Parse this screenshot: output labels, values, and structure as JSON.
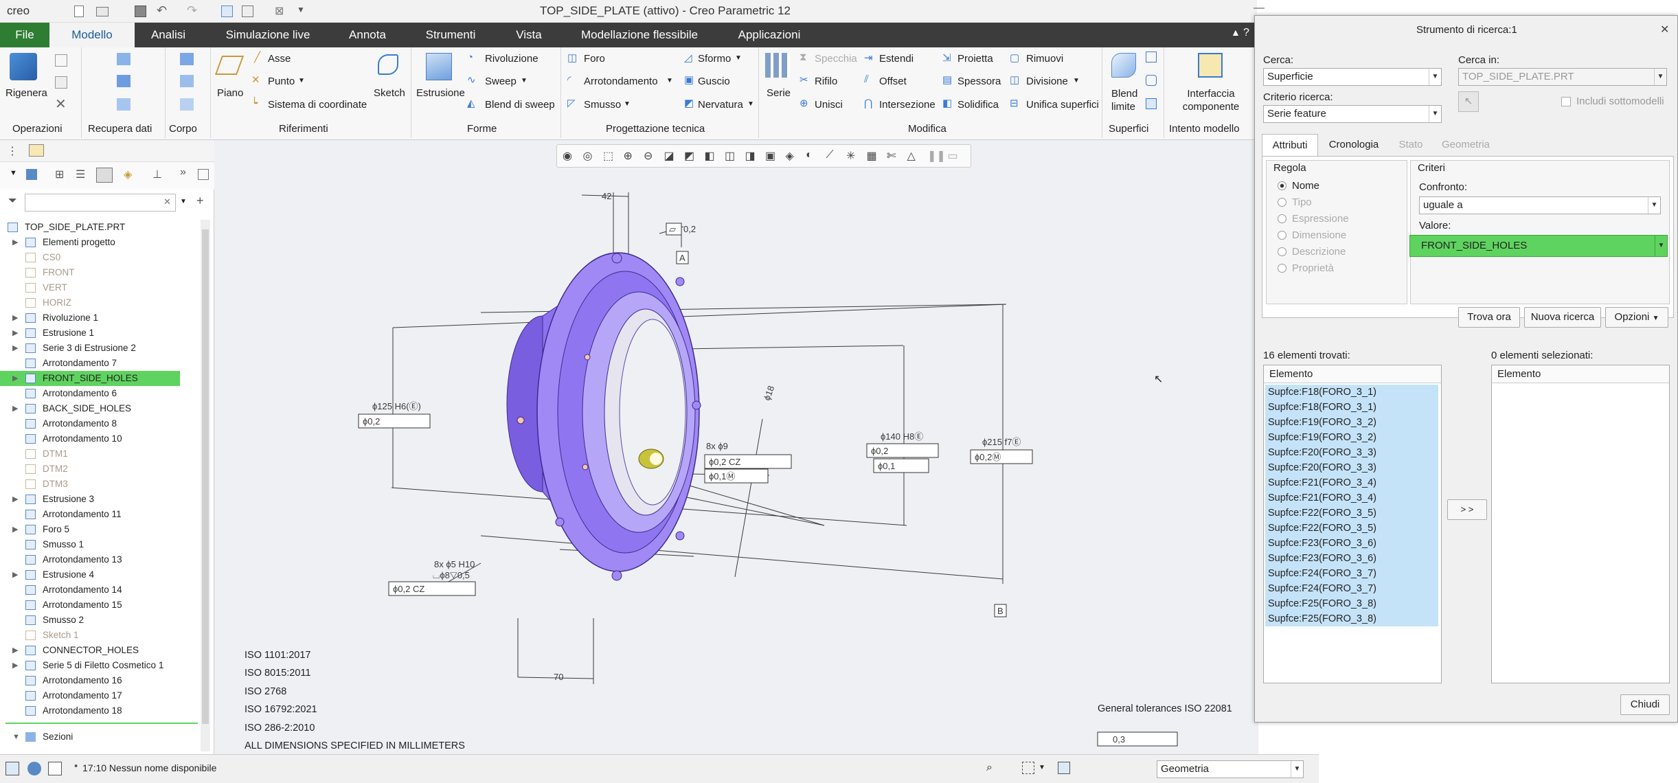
{
  "app": {
    "logo": "creo",
    "title": "TOP_SIDE_PLATE (attivo) - Creo Parametric 12"
  },
  "menu": [
    "File",
    "Modello",
    "Analisi",
    "Simulazione live",
    "Annota",
    "Strumenti",
    "Vista",
    "Modellazione flessibile",
    "Applicazioni"
  ],
  "ribbon": {
    "rigenera": "Rigenera",
    "asse": "Asse",
    "punto": "Punto",
    "sistema": "Sistema di coordinate",
    "piano": "Piano",
    "sketch": "Sketch",
    "estrusione": "Estrusione",
    "rivoluzione": "Rivoluzione",
    "sweep": "Sweep",
    "blend_sweep": "Blend di sweep",
    "foro": "Foro",
    "arrotondamento": "Arrotondamento",
    "smusso": "Smusso",
    "sformo": "Sformo",
    "guscio": "Guscio",
    "nervatura": "Nervatura",
    "serie": "Serie",
    "specchia": "Specchia",
    "rifilo": "Rifilo",
    "unisci": "Unisci",
    "estendi": "Estendi",
    "offset": "Offset",
    "intersezione": "Intersezione",
    "proietta": "Proietta",
    "spessora": "Spessora",
    "solidifica": "Solidifica",
    "rimuovi": "Rimuovi",
    "divisione": "Divisione",
    "unifica": "Unifica superfici",
    "blend_limite": "Blend limite",
    "interfaccia": "Interfaccia componente",
    "groups": [
      "Operazioni",
      "Recupera dati",
      "Corpo",
      "Riferimenti",
      "Forme",
      "Progettazione tecnica",
      "Modifica",
      "Superfici",
      "Intento modello"
    ]
  },
  "tree": {
    "filter_placeholder": "",
    "items": [
      {
        "label": "TOP_SIDE_PLATE.PRT",
        "dim": false,
        "exp": ""
      },
      {
        "label": "Elementi progetto",
        "dim": false,
        "exp": "▶"
      },
      {
        "label": "CS0",
        "dim": true,
        "exp": ""
      },
      {
        "label": "FRONT",
        "dim": true,
        "exp": ""
      },
      {
        "label": "VERT",
        "dim": true,
        "exp": ""
      },
      {
        "label": "HORIZ",
        "dim": true,
        "exp": ""
      },
      {
        "label": "Rivoluzione 1",
        "dim": false,
        "exp": "▶"
      },
      {
        "label": "Estrusione 1",
        "dim": false,
        "exp": "▶"
      },
      {
        "label": "Serie 3 di Estrusione 2",
        "dim": false,
        "exp": "▶"
      },
      {
        "label": "Arrotondamento 7",
        "dim": false,
        "exp": ""
      },
      {
        "label": "FRONT_SIDE_HOLES",
        "dim": false,
        "exp": "▶",
        "sel": true
      },
      {
        "label": "Arrotondamento 6",
        "dim": false,
        "exp": ""
      },
      {
        "label": "BACK_SIDE_HOLES",
        "dim": false,
        "exp": "▶"
      },
      {
        "label": "Arrotondamento 8",
        "dim": false,
        "exp": ""
      },
      {
        "label": "Arrotondamento 10",
        "dim": false,
        "exp": ""
      },
      {
        "label": "DTM1",
        "dim": true,
        "exp": ""
      },
      {
        "label": "DTM2",
        "dim": true,
        "exp": ""
      },
      {
        "label": "DTM3",
        "dim": true,
        "exp": ""
      },
      {
        "label": "Estrusione 3",
        "dim": false,
        "exp": "▶"
      },
      {
        "label": "Arrotondamento 11",
        "dim": false,
        "exp": ""
      },
      {
        "label": "Foro 5",
        "dim": false,
        "exp": "▶"
      },
      {
        "label": "Smusso 1",
        "dim": false,
        "exp": ""
      },
      {
        "label": "Arrotondamento 13",
        "dim": false,
        "exp": ""
      },
      {
        "label": "Estrusione 4",
        "dim": false,
        "exp": "▶"
      },
      {
        "label": "Arrotondamento 14",
        "dim": false,
        "exp": ""
      },
      {
        "label": "Arrotondamento 15",
        "dim": false,
        "exp": ""
      },
      {
        "label": "Smusso 2",
        "dim": false,
        "exp": ""
      },
      {
        "label": "Sketch 1",
        "dim": true,
        "exp": ""
      },
      {
        "label": "CONNECTOR_HOLES",
        "dim": false,
        "exp": "▶"
      },
      {
        "label": "Serie 5 di Filetto Cosmetico 1",
        "dim": false,
        "exp": "▶"
      },
      {
        "label": "Arrotondamento 16",
        "dim": false,
        "exp": ""
      },
      {
        "label": "Arrotondamento 17",
        "dim": false,
        "exp": ""
      },
      {
        "label": "Arrotondamento 18",
        "dim": false,
        "exp": ""
      }
    ],
    "sezioni": "Sezioni"
  },
  "drawing": {
    "notes": [
      "ISO 1101:2017",
      "ISO 8015:2011",
      "ISO 2768",
      "ISO 16792:2021",
      "ISO 286-2:2010",
      "ALL DIMENSIONS SPECIFIED IN MILLIMETERS"
    ],
    "general_tol": "General tolerances ISO 22081",
    "gen_fcf": "0,3",
    "d42": "42",
    "d70": "70",
    "flat": "0,2",
    "datumA": "A",
    "datumB": "B",
    "d125": "ϕ125 H6(Ⓔ)",
    "fcf125": "ϕ0,2",
    "d140": "ϕ140 H8Ⓔ",
    "fcf140a": "ϕ0,2",
    "fcf140b": "ϕ0,1",
    "d215": "ϕ215 f7Ⓔ",
    "fcf215": "ϕ0,2Ⓜ",
    "h9": "8x ϕ9",
    "fcf9a": "ϕ0,2 CZ",
    "fcf9b": "ϕ0,1Ⓜ",
    "h5": "8x ϕ5 H10",
    "h5b": "⌴ϕ8▽0,5",
    "fcf5": "ϕ0,2 CZ",
    "diag": "ϕ18"
  },
  "status": {
    "text": "17:10 Nessun nome disponibile",
    "filter": "Geometria"
  },
  "dialog": {
    "title": "Strumento di ricerca:1",
    "cerca_label": "Cerca:",
    "cerca_value": "Superficie",
    "cercain_label": "Cerca in:",
    "cercain_value": "TOP_SIDE_PLATE.PRT",
    "criterio_label": "Criterio ricerca:",
    "criterio_value": "Serie feature",
    "includi": "Includi sottomodelli",
    "tabs": [
      "Attributi",
      "Cronologia",
      "Stato",
      "Geometria"
    ],
    "regola": "Regola",
    "rules": [
      "Nome",
      "Tipo",
      "Espressione",
      "Dimensione",
      "Descrizione",
      "Proprietà"
    ],
    "criteri": "Criteri",
    "confronto_label": "Confronto:",
    "confronto_value": "uguale a",
    "valore_label": "Valore:",
    "valore_value": "FRONT_SIDE_HOLES",
    "trova": "Trova ora",
    "nuova": "Nuova ricerca",
    "opzioni": "Opzioni",
    "found": "16 elementi trovati:",
    "selected": "0 elementi selezionati:",
    "col": "Elemento",
    "col2": "Elemento",
    "move": "> >",
    "results": [
      "Supfce:F18(FORO_3_1)",
      "Supfce:F18(FORO_3_1)",
      "Supfce:F19(FORO_3_2)",
      "Supfce:F19(FORO_3_2)",
      "Supfce:F20(FORO_3_3)",
      "Supfce:F20(FORO_3_3)",
      "Supfce:F21(FORO_3_4)",
      "Supfce:F21(FORO_3_4)",
      "Supfce:F22(FORO_3_5)",
      "Supfce:F22(FORO_3_5)",
      "Supfce:F23(FORO_3_6)",
      "Supfce:F23(FORO_3_6)",
      "Supfce:F24(FORO_3_7)",
      "Supfce:F24(FORO_3_7)",
      "Supfce:F25(FORO_3_8)",
      "Supfce:F25(FORO_3_8)"
    ],
    "chiudi": "Chiudi"
  },
  "colors": {
    "highlight": "#5fd35f",
    "selection": "#c5e3f8",
    "part": "#9a7af0",
    "menubar": "#3c3c3c"
  }
}
